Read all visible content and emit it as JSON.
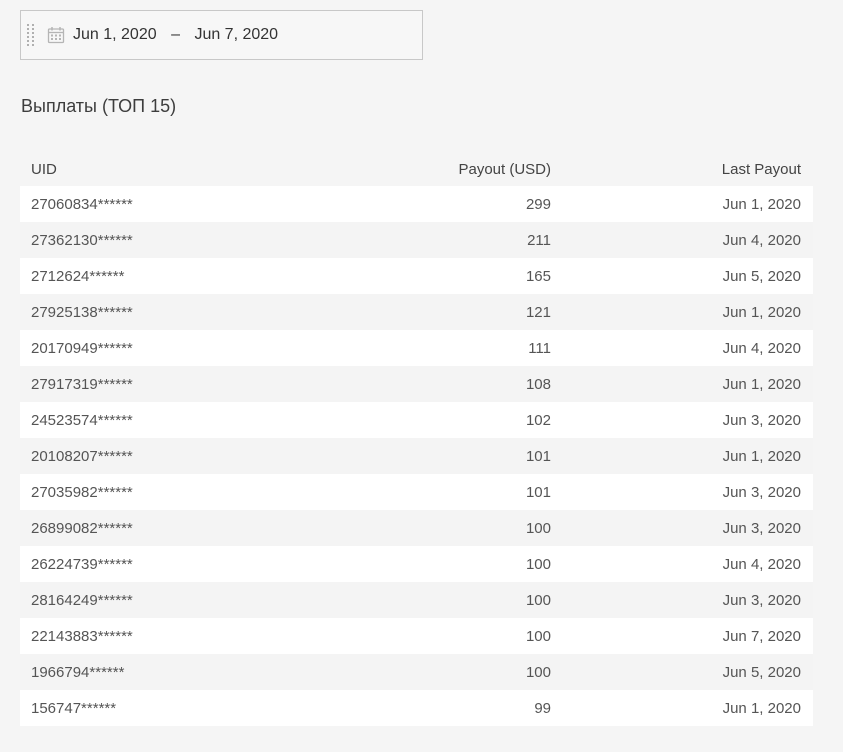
{
  "date_range": {
    "start": "Jun 1, 2020",
    "separator": "–",
    "end": "Jun 7, 2020"
  },
  "title": "Выплаты (ТОП 15)",
  "table": {
    "columns": [
      "UID",
      "Payout (USD)",
      "Last Payout"
    ],
    "rows": [
      {
        "uid": "27060834******",
        "payout": "299",
        "last": "Jun 1, 2020"
      },
      {
        "uid": "27362130******",
        "payout": "211",
        "last": "Jun 4, 2020"
      },
      {
        "uid": "2712624******",
        "payout": "165",
        "last": "Jun 5, 2020"
      },
      {
        "uid": "27925138******",
        "payout": "121",
        "last": "Jun 1, 2020"
      },
      {
        "uid": "20170949******",
        "payout": "111",
        "last": "Jun 4, 2020"
      },
      {
        "uid": "27917319******",
        "payout": "108",
        "last": "Jun 1, 2020"
      },
      {
        "uid": "24523574******",
        "payout": "102",
        "last": "Jun 3, 2020"
      },
      {
        "uid": "20108207******",
        "payout": "101",
        "last": "Jun 1, 2020"
      },
      {
        "uid": "27035982******",
        "payout": "101",
        "last": "Jun 3, 2020"
      },
      {
        "uid": "26899082******",
        "payout": "100",
        "last": "Jun 3, 2020"
      },
      {
        "uid": "26224739******",
        "payout": "100",
        "last": "Jun 4, 2020"
      },
      {
        "uid": "28164249******",
        "payout": "100",
        "last": "Jun 3, 2020"
      },
      {
        "uid": "22143883******",
        "payout": "100",
        "last": "Jun 7, 2020"
      },
      {
        "uid": "1966794******",
        "payout": "100",
        "last": "Jun 5, 2020"
      },
      {
        "uid": "156747******",
        "payout": "99",
        "last": "Jun 1, 2020"
      }
    ]
  }
}
